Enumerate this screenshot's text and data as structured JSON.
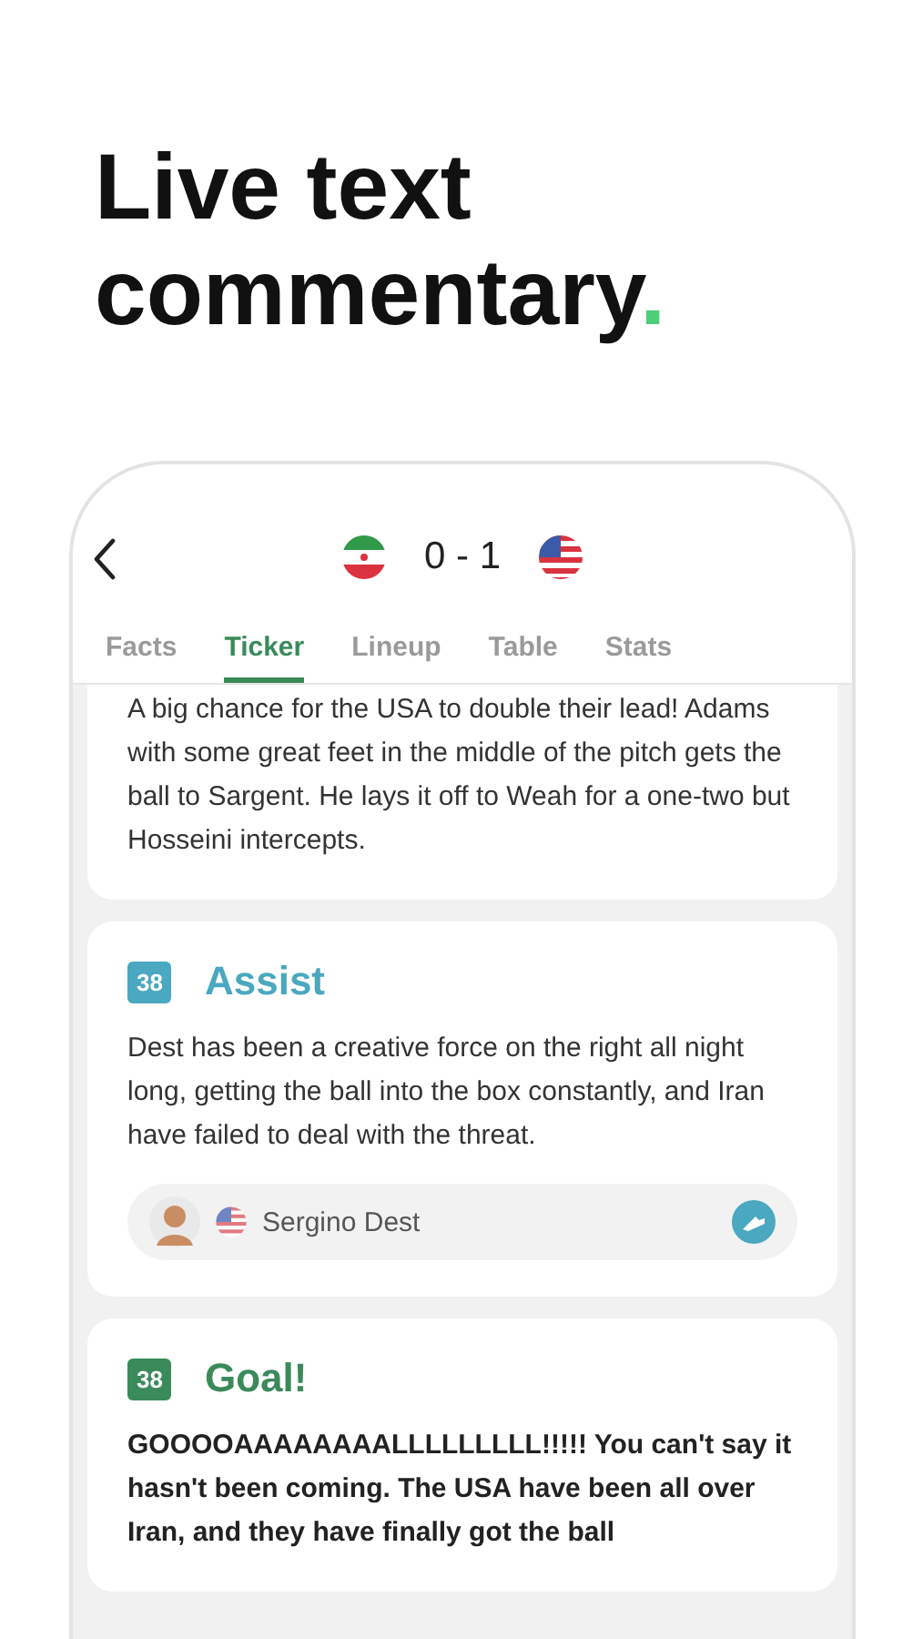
{
  "headline": {
    "text": "Live text commentary",
    "accent": "."
  },
  "match": {
    "score": "0 - 1"
  },
  "tabs": [
    {
      "label": "Facts",
      "selected": false
    },
    {
      "label": "Ticker",
      "selected": true
    },
    {
      "label": "Lineup",
      "selected": false
    },
    {
      "label": "Table",
      "selected": false
    },
    {
      "label": "Stats",
      "selected": false
    }
  ],
  "events": [
    {
      "kind": "text",
      "text": "A big chance for the USA to double their lead! Adams with some great feet in the middle of the pitch gets the ball to Sargent. He lays it off to Weah for a one-two but Hosseini intercepts."
    },
    {
      "kind": "assist",
      "minute": "38",
      "title": "Assist",
      "color": "#4aa8c0",
      "text": "Dest has been a creative force on the right all night long, getting the ball into the box constantly, and Iran have failed to deal with the threat.",
      "player": "Sergino Dest"
    },
    {
      "kind": "goal",
      "minute": "38",
      "title": "Goal!",
      "color": "#3a8a5a",
      "text": "GOOOOAAAAAAAALLLLLLLLL!!!!! You can't say it hasn't been coming. The USA have been all over Iran, and they have finally got the ball"
    }
  ]
}
